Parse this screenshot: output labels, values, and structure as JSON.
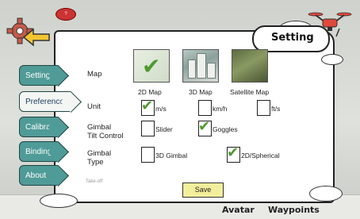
{
  "header": {
    "title": "Setting"
  },
  "help_badge": {
    "text": "?"
  },
  "tabs": [
    {
      "label": "Setting",
      "active": false
    },
    {
      "label": "Preferences",
      "active": true
    },
    {
      "label": "Calibration",
      "active": false
    },
    {
      "label": "Binding",
      "active": false
    },
    {
      "label": "About",
      "active": false
    }
  ],
  "map": {
    "label": "Map",
    "options": [
      {
        "caption": "2D Map",
        "selected": true
      },
      {
        "caption": "3D Map",
        "selected": false
      },
      {
        "caption": "Satellite Map",
        "selected": false
      }
    ]
  },
  "unit": {
    "label": "Unit",
    "options": [
      {
        "text": "m/s",
        "checked": true
      },
      {
        "text": "km/h",
        "checked": false
      },
      {
        "text": "ft/s",
        "checked": false
      }
    ]
  },
  "gimbal_tilt": {
    "label_line1": "Gimbal",
    "label_line2": "Tilt Control",
    "options": [
      {
        "text": "Slider",
        "checked": false
      },
      {
        "text": "Goggles",
        "checked": true
      }
    ]
  },
  "gimbal_type": {
    "label_line1": "Gimbal",
    "label_line2": "Type",
    "options": [
      {
        "text": "3D Gimbal",
        "checked": false
      },
      {
        "text": "2D/Spherical",
        "checked": true
      }
    ]
  },
  "partial_row": {
    "text": "Take-off"
  },
  "save_label": "Save",
  "bottom_bar": {
    "avatar": "Avatar",
    "waypoints": "Waypoints"
  },
  "colors": {
    "tab_bg": "#4f9b97",
    "check": "#4e9a2f",
    "save_bg": "#f3ee9b",
    "drone": "#e2473b"
  }
}
